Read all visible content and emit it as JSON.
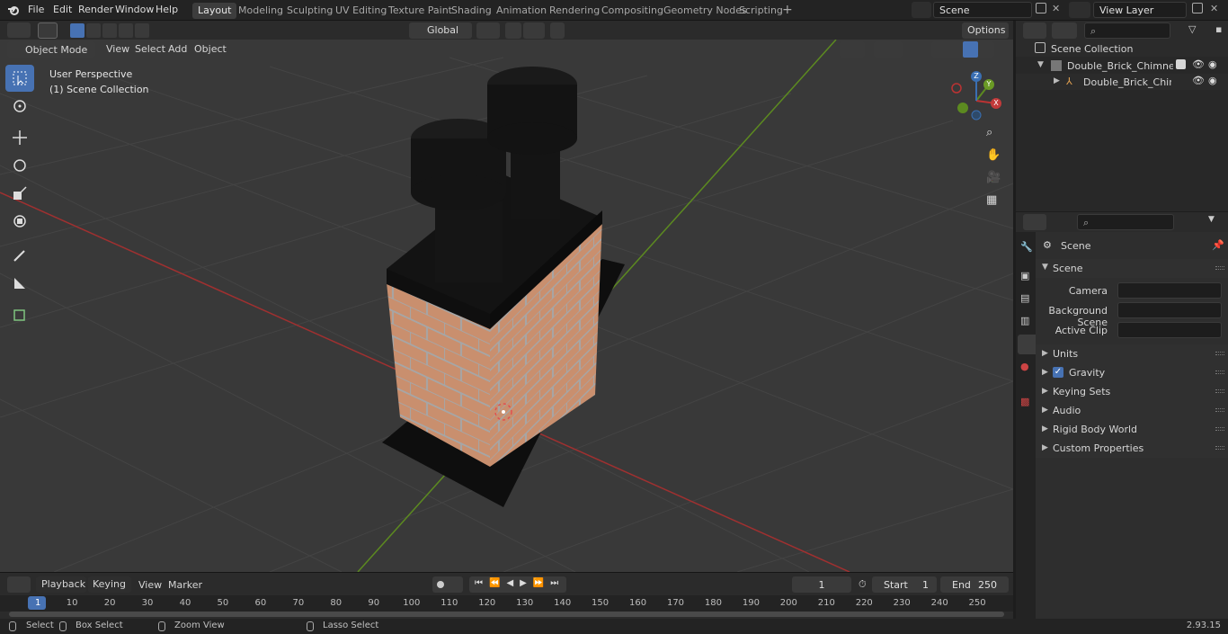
{
  "top_menu": {
    "file": "File",
    "edit": "Edit",
    "render": "Render",
    "window": "Window",
    "help": "Help"
  },
  "workspaces": [
    "Layout",
    "Modeling",
    "Sculpting",
    "UV Editing",
    "Texture Paint",
    "Shading",
    "Animation",
    "Rendering",
    "Compositing",
    "Geometry Nodes",
    "Scripting"
  ],
  "active_workspace": "Layout",
  "scene_field": "Scene",
  "view_layer_field": "View Layer",
  "viewport_header": {
    "mode": "Object Mode",
    "view": "View",
    "select": "Select",
    "add": "Add",
    "object": "Object",
    "orientation": "Global",
    "options": "Options"
  },
  "viewport_overlay_text": {
    "perspective": "User Perspective",
    "collection": "(1) Scene Collection"
  },
  "gizmo_axes": {
    "x": "X",
    "y": "Y",
    "z": "Z"
  },
  "outliner": {
    "root": "Scene Collection",
    "items": [
      {
        "label": "Double_Brick_Chimney_Corne"
      },
      {
        "label": "Double_Brick_Chimney_C"
      }
    ]
  },
  "properties": {
    "header": "Scene",
    "section_scene": "Scene",
    "camera_label": "Camera",
    "background_scene_label": "Background Scene",
    "active_clip_label": "Active Clip",
    "sections": [
      "Units",
      "Gravity",
      "Keying Sets",
      "Audio",
      "Rigid Body World",
      "Custom Properties"
    ],
    "gravity_checked": true
  },
  "timeline": {
    "playback": "Playback",
    "keying": "Keying",
    "view": "View",
    "marker": "Marker",
    "current_frame": "1",
    "start_label": "Start",
    "start_value": "1",
    "end_label": "End",
    "end_value": "250",
    "ruler": [
      "1",
      "10",
      "20",
      "30",
      "40",
      "50",
      "60",
      "70",
      "80",
      "90",
      "100",
      "110",
      "120",
      "130",
      "140",
      "150",
      "160",
      "170",
      "180",
      "190",
      "200",
      "210",
      "220",
      "230",
      "240",
      "250"
    ]
  },
  "status_bar": {
    "select": "Select",
    "box_select": "Box Select",
    "zoom_view": "Zoom View",
    "lasso_select": "Lasso Select",
    "version": "2.93.15"
  },
  "colors": {
    "accent": "#4772b3",
    "brick": "#c98f6e",
    "mortar": "#9a9a9a",
    "x_axis": "#c23a3a",
    "y_axis": "#6a9a25"
  }
}
